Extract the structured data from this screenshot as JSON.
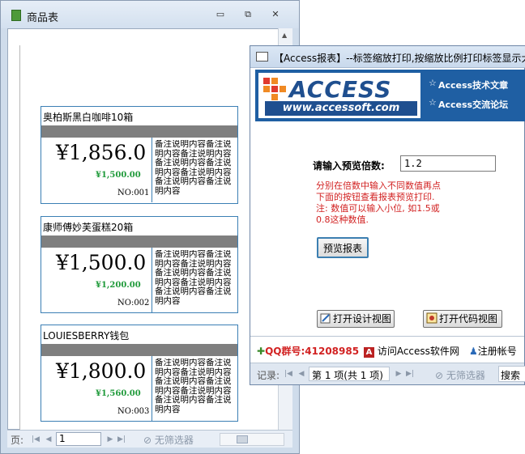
{
  "report_window": {
    "title": "商品表",
    "controls": {
      "minimize": "▭",
      "restore": "⧉",
      "close": "✕"
    },
    "labels": [
      {
        "name": "奥柏斯黑白咖啡10箱",
        "price": "¥1,856.0",
        "discount_price": "¥1,500.00",
        "number": "NO:001",
        "note": "备注说明内容备注说明内容备注说明内容备注说明内容备注说明内容备注说明内容备注说明内容备注说明内容"
      },
      {
        "name": "康师傅妙芙蛋糕20箱",
        "price": "¥1,500.0",
        "discount_price": "¥1,200.00",
        "number": "NO:002",
        "note": "备注说明内容备注说明内容备注说明内容备注说明内容备注说明内容备注说明内容备注说明内容备注说明内容"
      },
      {
        "name": "LOUIESBERRY钱包",
        "price": "¥1,800.0",
        "discount_price": "¥1,560.00",
        "number": "NO:003",
        "note": "备注说明内容备注说明内容备注说明内容备注说明内容备注说明内容备注说明内容备注说明内容备注说明内容"
      }
    ],
    "status": {
      "page_label": "页:",
      "page_value": "1",
      "filter_label": "无筛选器"
    }
  },
  "form_window": {
    "title": "【Access报表】--标签缩放打印,按缩放比例打印标签显示大",
    "banner": {
      "logo_text": "ACCESS",
      "logo_url": "www.accessoft.com",
      "links": [
        "Access技术文章",
        "Access交流论坛"
      ]
    },
    "zoom": {
      "label": "请输入预览倍数:",
      "value": "1.2"
    },
    "hints": [
      "分别在倍数中输入不同数值再点",
      "下面的按钮查看报表预览打印.",
      "注: 数值可以输入小位, 如1.5或",
      "0.8这种数值."
    ],
    "buttons": {
      "preview": "预览报表",
      "design_view": "打开设计视图",
      "code_view": "打开代码视图"
    },
    "footer": {
      "qq_group": "QQ群号:41208985",
      "visit": "访问Access软件网",
      "register": "注册帐号"
    },
    "nav": {
      "record_label": "记录:",
      "record_value": "第 1 项(共 1 项)",
      "filter_label": "无筛选器",
      "search": "搜索"
    }
  },
  "colors": {
    "accent": "#3b7fb4",
    "banner": "#1f5fa3",
    "hint_red": "#d22222",
    "discount_green": "#1f9a3a"
  }
}
